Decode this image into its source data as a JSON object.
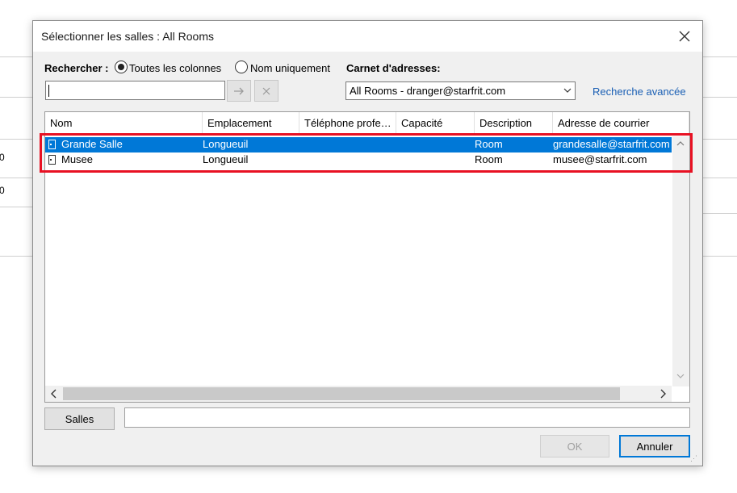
{
  "background": {
    "left_values": [
      "0",
      "0"
    ]
  },
  "dialog": {
    "title": "Sélectionner les salles : All Rooms",
    "close_icon": "close-icon"
  },
  "search": {
    "label": "Rechercher :",
    "option_all": "Toutes les colonnes",
    "option_name": "Nom uniquement",
    "selected_option": "Toutes les colonnes",
    "value": "",
    "go_icon": "arrow-right-icon",
    "clear_icon": "x-icon"
  },
  "address_book": {
    "label": "Carnet d'adresses:",
    "selected": "All Rooms - dranger@starfrit.com",
    "advanced_link": "Recherche avancée"
  },
  "list": {
    "columns": [
      "Nom",
      "Emplacement",
      "Téléphone profe…",
      "Capacité",
      "Description",
      "Adresse de courrier"
    ],
    "rows": [
      {
        "name": "Grande Salle",
        "location": "Longueuil",
        "phone": "",
        "capacity": "",
        "description": "Room",
        "email": "grandesalle@starfrit.com",
        "selected": true
      },
      {
        "name": "Musee",
        "location": "Longueuil",
        "phone": "",
        "capacity": "",
        "description": "Room",
        "email": "musee@starfrit.com",
        "selected": false
      }
    ]
  },
  "footer": {
    "rooms_button": "Salles",
    "rooms_value": "",
    "ok_label": "OK",
    "cancel_label": "Annuler"
  },
  "colors": {
    "selection": "#0078d7",
    "highlight_border": "#e81123",
    "link": "#1a5fb4"
  }
}
